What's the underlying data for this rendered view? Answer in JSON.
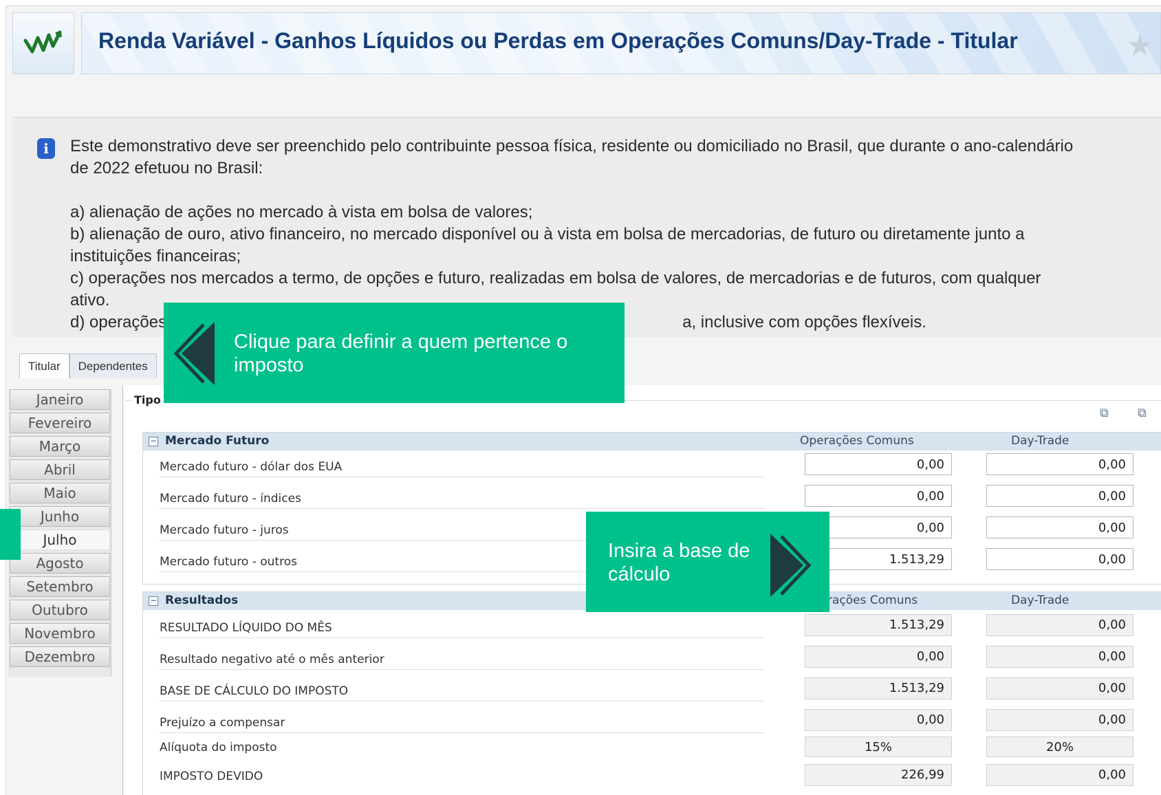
{
  "header": {
    "title": "Renda Variável - Ganhos Líquidos ou Perdas em Operações Comuns/Day-Trade - Titular"
  },
  "info": {
    "lines": [
      "Este demonstrativo deve ser preenchido pelo contribuinte pessoa física, residente ou domiciliado no Brasil, que durante o ano-calendário",
      "de 2022 efetuou no Brasil:",
      "a) alienação de ações no mercado à vista em bolsa de valores;",
      "b) alienação de ouro, ativo financeiro, no mercado disponível ou à vista em bolsa de mercadorias, de futuro ou diretamente junto a",
      "instituições financeiras;",
      "c) operações nos mercados a termo, de opções e futuro, realizadas em bolsa de valores, de mercadorias e de futuros, com qualquer",
      "ativo.",
      "d) operações",
      "a, inclusive com opções flexíveis."
    ]
  },
  "tabs": [
    "Titular",
    "Dependentes"
  ],
  "months": [
    "Janeiro",
    "Fevereiro",
    "Março",
    "Abril",
    "Maio",
    "Junho",
    "Julho",
    "Agosto",
    "Setembro",
    "Outubro",
    "Novembro",
    "Dezembro"
  ],
  "selected_month": "Julho",
  "fieldset_legend": "Tipo",
  "futuro": {
    "title": "Mercado Futuro",
    "col_comuns": "Operações Comuns",
    "col_daytrade": "Day-Trade",
    "rows": [
      {
        "label": "Mercado futuro - dólar dos EUA",
        "comuns": "0,00",
        "daytrade": "0,00"
      },
      {
        "label": "Mercado futuro - índices",
        "comuns": "0,00",
        "daytrade": "0,00"
      },
      {
        "label": "Mercado futuro - juros",
        "comuns": "0,00",
        "daytrade": "0,00"
      },
      {
        "label": "Mercado futuro - outros",
        "comuns": "1.513,29",
        "daytrade": "0,00"
      }
    ]
  },
  "resultados": {
    "title": "Resultados",
    "col_comuns": "rações Comuns",
    "col_daytrade": "Day-Trade",
    "rows": [
      {
        "label": "RESULTADO LÍQUIDO DO MÊS",
        "comuns": "1.513,29",
        "daytrade": "0,00"
      },
      {
        "label": "Resultado negativo até o mês anterior",
        "comuns": "0,00",
        "daytrade": "0,00"
      },
      {
        "label": "BASE DE CÁLCULO DO IMPOSTO",
        "comuns": "1.513,29",
        "daytrade": "0,00"
      },
      {
        "label": "Prejuízo a compensar",
        "comuns": "0,00",
        "daytrade": "0,00"
      },
      {
        "label": "Alíquota do imposto",
        "comuns": "15%",
        "daytrade": "20%"
      },
      {
        "label": "IMPOSTO DEVIDO",
        "comuns": "226,99",
        "daytrade": "0,00"
      }
    ]
  },
  "callouts": {
    "owner": "Clique para definir a quem pertence o imposto",
    "base": "Insira a base de cálculo"
  },
  "colors": {
    "callout": "#00c08b",
    "title": "#163f78",
    "section_head": "#d7e3ef"
  }
}
